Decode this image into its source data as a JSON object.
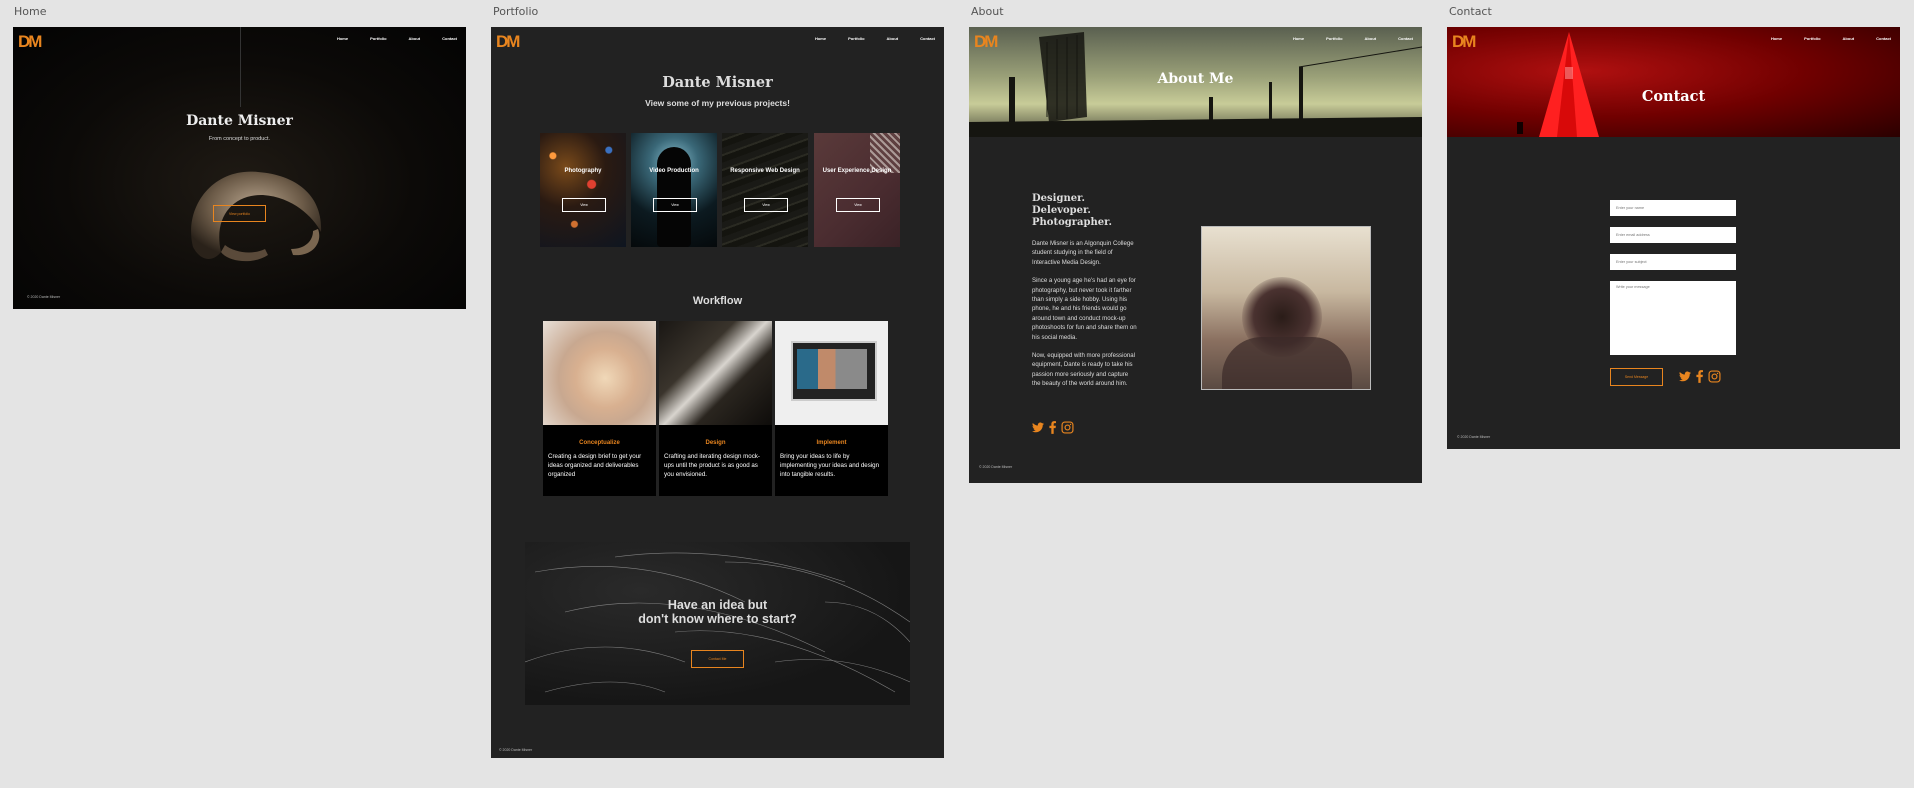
{
  "artboards": {
    "home": "Home",
    "portfolio": "Portfolio",
    "about": "About",
    "contact": "Contact"
  },
  "brand": {
    "logo_text": "DM",
    "accent": "#e8851f"
  },
  "nav": [
    "Home",
    "Portfolio",
    "About",
    "Contact"
  ],
  "footer": "© 2020 Dante Misner",
  "home": {
    "name": "Dante Misner",
    "tagline": "From concept to product.",
    "cta": "View portfolio"
  },
  "portfolio": {
    "name": "Dante Misner",
    "subtitle": "View some of my previous projects!",
    "categories": [
      {
        "title": "Photography",
        "button": "View"
      },
      {
        "title": "Video Production",
        "button": "View"
      },
      {
        "title": "Responsive Web Design",
        "button": "View"
      },
      {
        "title": "User Experience Design",
        "button": "View"
      }
    ],
    "workflow_heading": "Workflow",
    "workflow": [
      {
        "title": "Conceptualize",
        "desc": "Creating a design brief to get your ideas organized and deliverables organized"
      },
      {
        "title": "Design",
        "desc": "Crafting and iterating design mock-ups until the product is as good as you envisioned."
      },
      {
        "title": "Implement",
        "desc": "Bring your ideas to life by implementing your ideas and design into tangible results."
      }
    ],
    "cta_line1": "Have an idea but",
    "cta_line2": "don't know where to start?",
    "cta_button": "Contact Me"
  },
  "about": {
    "title": "About Me",
    "heading_lines": [
      "Designer.",
      "Delevoper.",
      "Photographer."
    ],
    "paragraphs": [
      "Dante Misner is an Algonquin College student studying in the field of Interactive Media Design.",
      "Since a young age he's had an eye for photography, but never took it farther than simply a side hobby. Using his phone, he and his friends would go around town and conduct mock-up photoshoots for fun and share them on his social media.",
      "Now, equipped with more professional equipment, Dante is ready to take his passion more seriously and capture the beauty of the world around him."
    ],
    "socials": [
      "twitter-icon",
      "facebook-icon",
      "instagram-icon"
    ]
  },
  "contact": {
    "title": "Contact",
    "name_placeholder": "Enter your name",
    "email_placeholder": "Enter email address",
    "subject_placeholder": "Enter your subject",
    "message_placeholder": "Write your message",
    "send": "Send Message"
  }
}
